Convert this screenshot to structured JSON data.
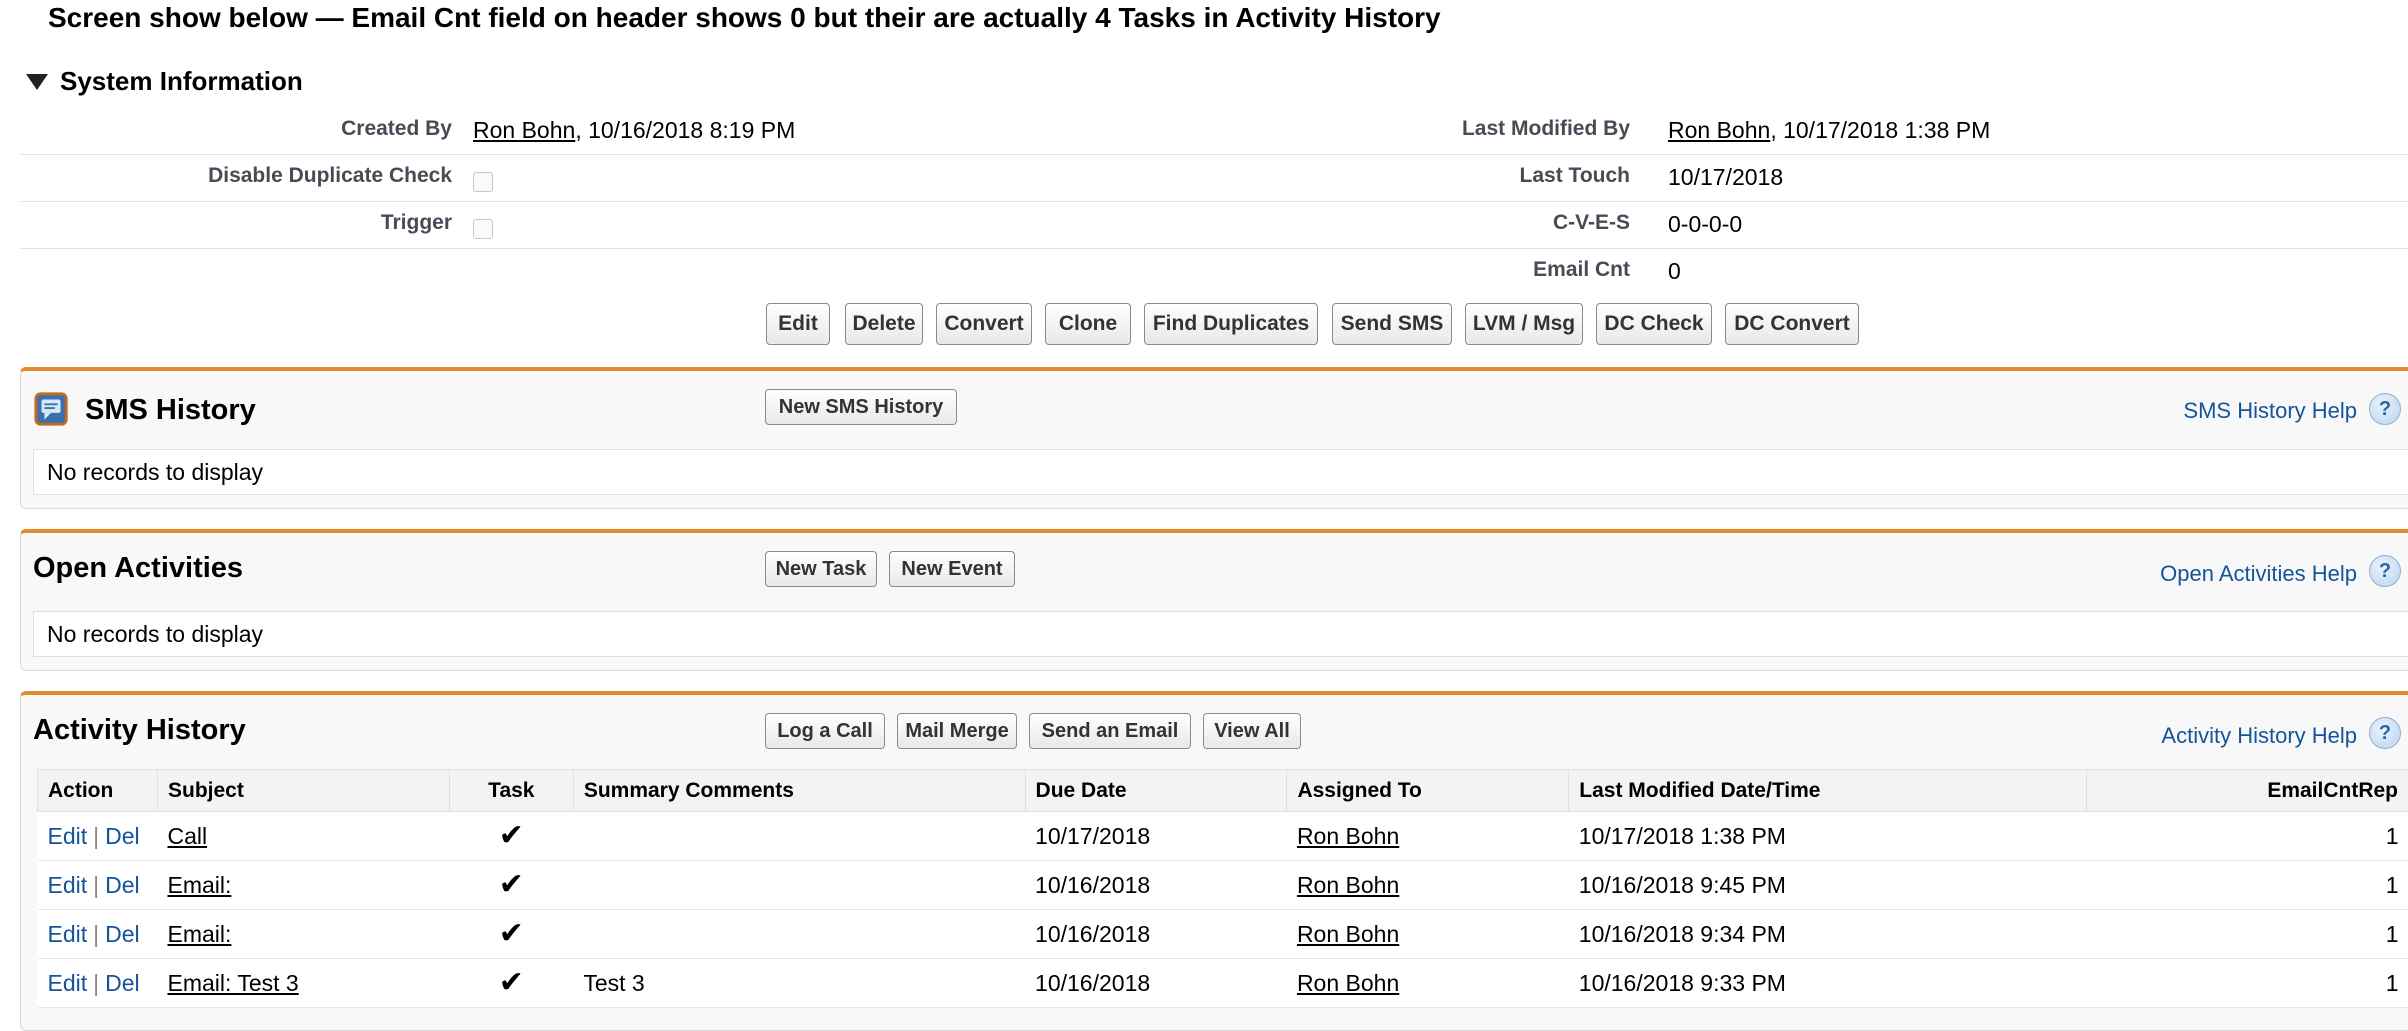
{
  "caption": "Screen show below — Email Cnt field on header shows 0 but their are actually 4 Tasks in Activity History",
  "system_info": {
    "title": "System Information",
    "created_by_label": "Created By",
    "created_by_user": "Ron Bohn",
    "created_by_date": ", 10/16/2018 8:19 PM",
    "last_modified_by_label": "Last Modified By",
    "last_modified_by_user": "Ron Bohn",
    "last_modified_by_date": ", 10/17/2018 1:38 PM",
    "disable_dup_label": "Disable Duplicate Check",
    "last_touch_label": "Last Touch",
    "last_touch_value": "10/17/2018",
    "trigger_label": "Trigger",
    "cves_label": "C-V-E-S",
    "cves_value": "0-0-0-0",
    "email_cnt_label": "Email Cnt",
    "email_cnt_value": "0"
  },
  "buttons": {
    "edit": "Edit",
    "delete": "Delete",
    "convert": "Convert",
    "clone": "Clone",
    "find_duplicates": "Find Duplicates",
    "send_sms": "Send SMS",
    "lvm_msg": "LVM / Msg",
    "dc_check": "DC Check",
    "dc_convert": "DC Convert"
  },
  "sms_history": {
    "title": "SMS History",
    "new_button": "New SMS History",
    "help": "SMS History Help",
    "empty": "No records to display"
  },
  "open_activities": {
    "title": "Open Activities",
    "new_task": "New Task",
    "new_event": "New Event",
    "help": "Open Activities Help",
    "empty": "No records to display"
  },
  "activity_history": {
    "title": "Activity History",
    "log_call": "Log a Call",
    "mail_merge": "Mail Merge",
    "send_email": "Send an Email",
    "view_all": "View All",
    "help": "Activity History Help",
    "columns": [
      "Action",
      "Subject",
      "Task",
      "Summary Comments",
      "Due Date",
      "Assigned To",
      "Last Modified Date/Time",
      "EmailCntRep"
    ],
    "edit_label": "Edit",
    "del_label": "Del",
    "separator": "|",
    "check": "✔",
    "rows": [
      {
        "subject": "Call",
        "comments": "",
        "due": "10/17/2018",
        "assigned": "Ron Bohn",
        "modified": "10/17/2018 1:38 PM",
        "count": "1"
      },
      {
        "subject": "Email:",
        "comments": "",
        "due": "10/16/2018",
        "assigned": "Ron Bohn",
        "modified": "10/16/2018 9:45 PM",
        "count": "1"
      },
      {
        "subject": "Email:",
        "comments": "",
        "due": "10/16/2018",
        "assigned": "Ron Bohn",
        "modified": "10/16/2018 9:34 PM",
        "count": "1"
      },
      {
        "subject": "Email: Test 3",
        "comments": "Test 3",
        "due": "10/16/2018",
        "assigned": "Ron Bohn",
        "modified": "10/16/2018 9:33 PM",
        "count": "1"
      }
    ]
  },
  "colors": {
    "accent_orange": "#e08c2f",
    "link_blue": "#15549a"
  }
}
